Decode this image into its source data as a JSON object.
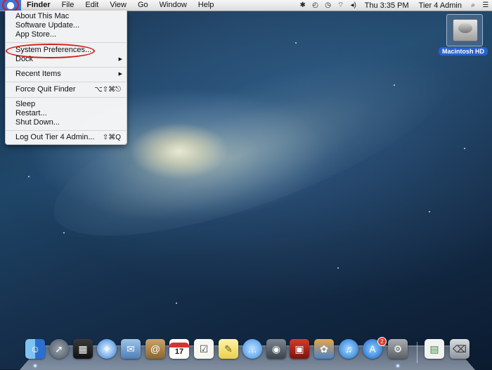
{
  "menubar": {
    "apple_icon": "apple-logo-icon",
    "app_name": "Finder",
    "menus": [
      "File",
      "Edit",
      "View",
      "Go",
      "Window",
      "Help"
    ],
    "clock": "Thu 3:35 PM",
    "user": "Tier 4 Admin",
    "status_icons": [
      "bluetooth-icon",
      "time-machine-icon",
      "clock-icon",
      "wifi-icon",
      "volume-icon",
      "spotlight-icon",
      "notification-list-icon"
    ]
  },
  "apple_menu": {
    "items": [
      {
        "label": "About This Mac"
      },
      {
        "label": "Software Update..."
      },
      {
        "label": "App Store..."
      },
      {
        "label": "System Preferences..."
      },
      {
        "label": "Dock"
      },
      {
        "label": "Recent Items"
      },
      {
        "label": "Force Quit Finder",
        "shortcut": "⌥⇧⌘⎋"
      },
      {
        "label": "Sleep"
      },
      {
        "label": "Restart..."
      },
      {
        "label": "Shut Down..."
      },
      {
        "label": "Log Out Tier 4 Admin...",
        "shortcut": "⇧⌘Q"
      }
    ],
    "submenu_arrow": "▶"
  },
  "desktop": {
    "drive_label": "Macintosh HD"
  },
  "dock": {
    "calendar_day": "17",
    "appstore_badge": "2",
    "icons": [
      "finder-icon",
      "launchpad-icon",
      "mission-control-icon",
      "safari-icon",
      "mail-icon",
      "contacts-icon",
      "calendar-icon",
      "reminders-icon",
      "notes-icon",
      "messages-icon",
      "facetime-icon",
      "photo-booth-icon",
      "iphoto-icon",
      "itunes-icon",
      "app-store-icon",
      "system-preferences-icon",
      "document-icon",
      "trash-icon"
    ]
  },
  "colors": {
    "highlight_ring": "#d31c1c",
    "selection_blue": "#3d73d6"
  }
}
